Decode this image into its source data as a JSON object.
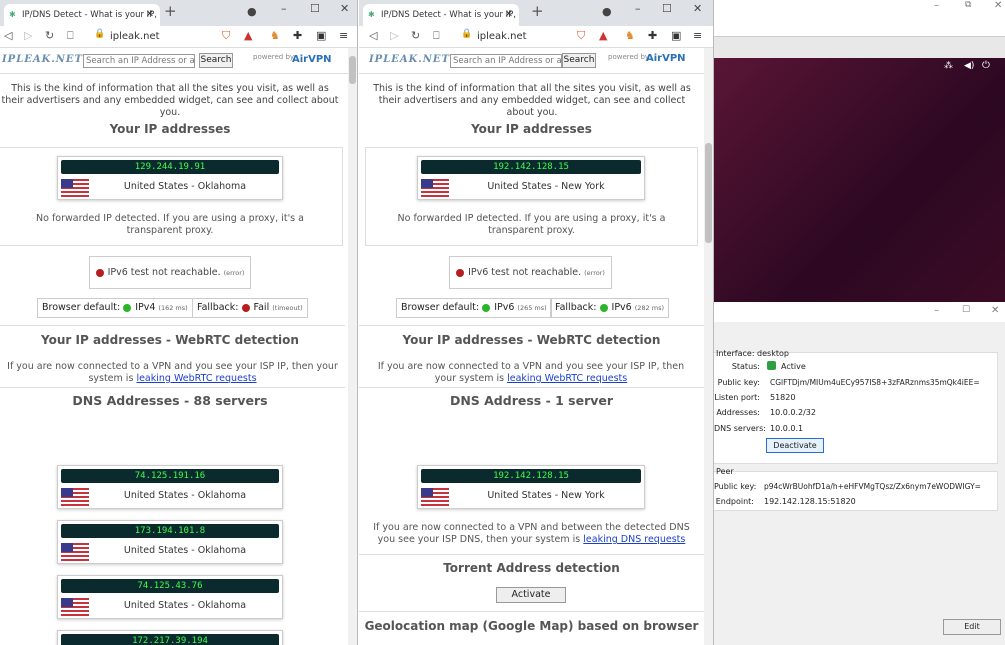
{
  "browser": {
    "tab_title": "IP/DNS Detect - What is your IP, …",
    "url": "ipleak.net"
  },
  "site": {
    "logo": "IPLEAK.NET",
    "search_placeholder": "Search an IP Address or a",
    "search_button": "Search",
    "powered_by": "powered by",
    "airvpn": "AirVPN",
    "intro": "This is the kind of information that all the sites you visit, as well as their advertisers and any embedded widget, can see and collect about you.",
    "your_ip_heading": "Your IP addresses",
    "no_forward": "No forwarded IP detected. If you are using a proxy, it's a transparent proxy.",
    "ipv6_test": "IPv6 test not reachable.",
    "error_tag": "(error)",
    "browser_default_label": "Browser default:",
    "fallback_label": "Fallback:",
    "webrtc_heading": "Your IP addresses - WebRTC detection",
    "webrtc_text": "If you are now connected to a VPN and you see your ISP IP, then your system is",
    "webrtc_link": "leaking WebRTC requests"
  },
  "left": {
    "ip": "129.244.19.91",
    "location": "United States - Oklahoma",
    "default_proto": "IPv4",
    "default_ms": "(162 ms)",
    "fallback_value": "Fail",
    "fallback_tag": "(timeout)",
    "dns_heading": "DNS Addresses - 88 servers",
    "dns": [
      {
        "ip": "74.125.191.16",
        "location": "United States - Oklahoma"
      },
      {
        "ip": "173.194.101.8",
        "location": "United States - Oklahoma"
      },
      {
        "ip": "74.125.43.76",
        "location": "United States - Oklahoma"
      },
      {
        "ip": "172.217.39.194",
        "location": ""
      }
    ]
  },
  "right": {
    "ip": "192.142.128.15",
    "location": "United States - New York",
    "default_proto": "IPv6",
    "default_ms": "(265 ms)",
    "fallback_value": "IPv6",
    "fallback_tag": "(282 ms)",
    "dns_heading": "DNS Address - 1 server",
    "dns_ip": "192.142.128.15",
    "dns_location": "United States - New York",
    "dns_note": "If you are now connected to a VPN and between the detected DNS you see your ISP DNS, then your system is",
    "dns_link": "leaking DNS requests",
    "torrent_heading": "Torrent Address detection",
    "activate": "Activate",
    "geo_heading": "Geolocation map (Google Map) based on browser"
  },
  "wireguard": {
    "interface": "Interface: desktop",
    "status_label": "Status:",
    "status_value": "Active",
    "pubkey_label": "Public key:",
    "pubkey_value": "CGlFTDjm/MIUm4uECy957IS8+3zFARznms35mQk4iEE=",
    "port_label": "Listen port:",
    "port_value": "51820",
    "addr_label": "Addresses:",
    "addr_value": "10.0.0.2/32",
    "dns_label": "DNS servers:",
    "dns_value": "10.0.0.1",
    "deactivate": "Deactivate",
    "peer": "Peer",
    "peer_pubkey_label": "Public key:",
    "peer_pubkey_value": "p94cWrBUohfD1a/h+eHFVMgTQsz/Zx6nym7eWODWIGY=",
    "endpoint_label": "Endpoint:",
    "endpoint_value": "192.142.128.15:51820",
    "edit": "Edit"
  }
}
